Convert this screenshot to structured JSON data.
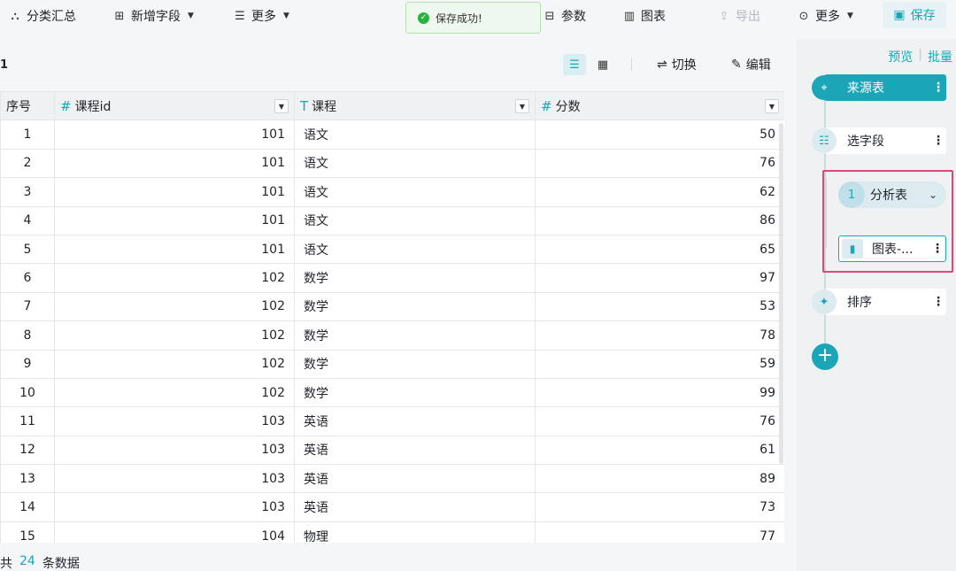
{
  "toolbar": {
    "group_summary": "分类汇总",
    "add_field": "新增字段",
    "more_left": "更多",
    "params": "参数",
    "chart": "图表",
    "export": "导出",
    "more_right": "更多",
    "save": "保存"
  },
  "toast": {
    "message": "保存成功!"
  },
  "main": {
    "page_num": "1",
    "switch_label": "切换",
    "edit_label": "编辑"
  },
  "table": {
    "headers": {
      "index": "序号",
      "course_id": "课程id",
      "course": "课程",
      "score": "分数"
    },
    "rows": [
      [
        "1",
        "101",
        "语文",
        "50"
      ],
      [
        "2",
        "101",
        "语文",
        "76"
      ],
      [
        "3",
        "101",
        "语文",
        "62"
      ],
      [
        "4",
        "101",
        "语文",
        "86"
      ],
      [
        "5",
        "101",
        "语文",
        "65"
      ],
      [
        "6",
        "102",
        "数学",
        "97"
      ],
      [
        "7",
        "102",
        "数学",
        "53"
      ],
      [
        "8",
        "102",
        "数学",
        "78"
      ],
      [
        "9",
        "102",
        "数学",
        "59"
      ],
      [
        "10",
        "102",
        "数学",
        "99"
      ],
      [
        "11",
        "103",
        "英语",
        "76"
      ],
      [
        "12",
        "103",
        "英语",
        "61"
      ],
      [
        "13",
        "103",
        "英语",
        "89"
      ],
      [
        "14",
        "103",
        "英语",
        "73"
      ],
      [
        "15",
        "104",
        "物理",
        "77"
      ]
    ]
  },
  "footer": {
    "prefix": "共",
    "count": "24",
    "suffix": "条数据"
  },
  "sidebar": {
    "preview": "预览",
    "batch": "批量",
    "source_table": "来源表",
    "select_fields": "选字段",
    "analysis_table": "分析表",
    "analysis_index": "1",
    "chart_node": "图表-...",
    "sort": "排序"
  },
  "colors": {
    "accent": "#1aa6b7",
    "highlight_border": "#e0457b",
    "toast_success": "#29b33e"
  }
}
